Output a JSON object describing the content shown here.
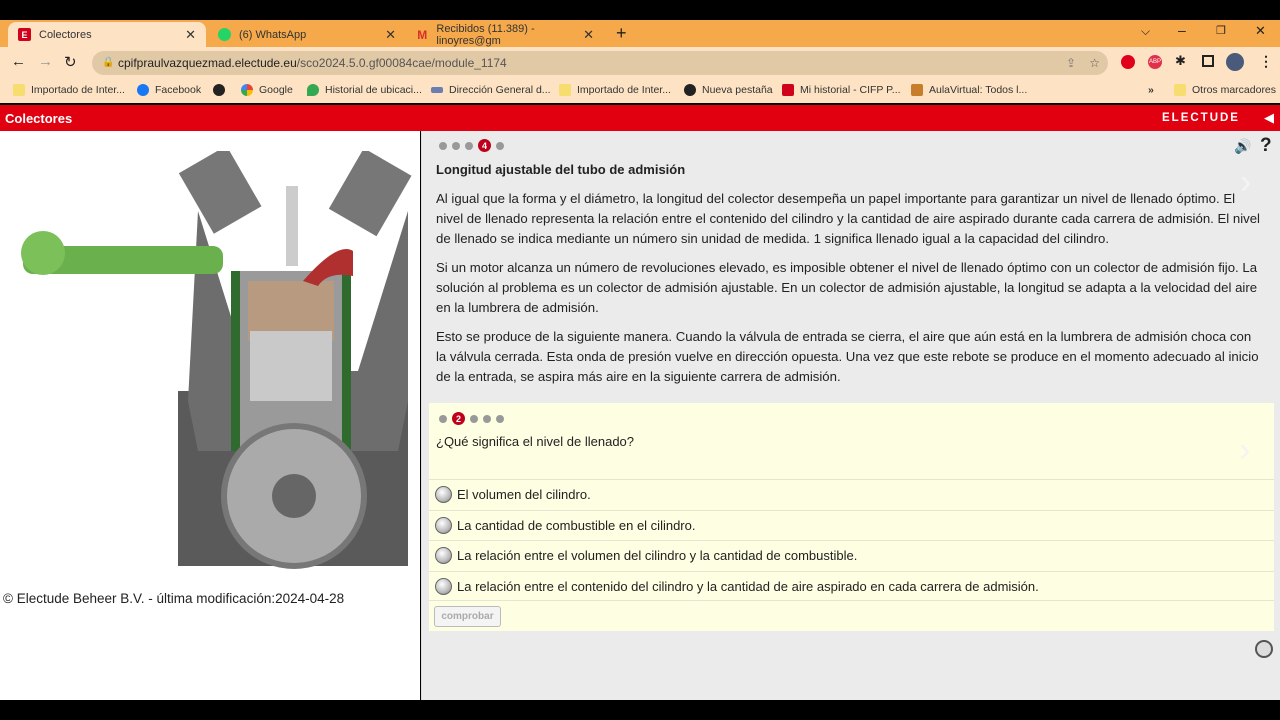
{
  "browser": {
    "tabs": [
      {
        "label": "Colectores",
        "active": true
      },
      {
        "label": "(6) WhatsApp"
      },
      {
        "label": "Recibidos (11.389) - linoyres@gm"
      }
    ],
    "url_host": "cpifpraulvazquezmad.electude.eu",
    "url_path": "/sco2024.5.0.gf00084cae/module_1174",
    "bookmarks": [
      "Importado de Inter...",
      "Facebook",
      "",
      "Google",
      "Historial de ubicaci...",
      "Dirección General d...",
      "Importado de Inter...",
      "Nueva pestaña",
      "Mi historial - CIFP P...",
      "AulaVirtual: Todos l..."
    ],
    "bookmarks_more": "»",
    "other_bookmarks": "Otros marcadores"
  },
  "app": {
    "title": "Colectores",
    "brand": "ELECTUDE",
    "accent": "#e00010"
  },
  "left": {
    "footer": "© Electude Beheer B.V. - última modificación:2024-04-28"
  },
  "lesson": {
    "page_current": "4",
    "page_total": 5,
    "title": "Longitud ajustable del tubo de admisión",
    "paragraphs": [
      "Al igual que la forma y el diámetro, la longitud del colector desempeña un papel importante para garantizar un nivel de llenado óptimo. El nivel de llenado representa la relación entre el contenido del cilindro y la cantidad de aire aspirado durante cada carrera de admisión. El nivel de llenado se indica mediante un número sin unidad de medida. 1 significa llenado igual a la capacidad del cilindro.",
      "Si un motor alcanza un número de revoluciones elevado, es imposible obtener el nivel de llenado óptimo con un colector de admisión fijo. La solución al problema es un colector de admisión ajustable. En un colector de admisión ajustable, la longitud se adapta a la velocidad del aire en la lumbrera de admisión.",
      "Esto se produce de la siguiente manera. Cuando la válvula de entrada se cierra, el aire que aún está en la lumbrera de admisión choca con la válvula cerrada. Esta onda de presión vuelve en dirección opuesta. Una vez que este rebote se produce en el momento adecuado al inicio de la entrada, se aspira más aire en la siguiente carrera de admisión."
    ]
  },
  "quiz": {
    "page_current": "2",
    "page_total": 5,
    "question": "¿Qué significa el nivel de llenado?",
    "options": [
      "El volumen del cilindro.",
      "La cantidad de combustible en el cilindro.",
      "La relación entre el volumen del cilindro y la cantidad de combustible.",
      "La relación entre el contenido del cilindro y la cantidad de aire aspirado en cada carrera de admisión."
    ],
    "check_label": "comprobar"
  }
}
